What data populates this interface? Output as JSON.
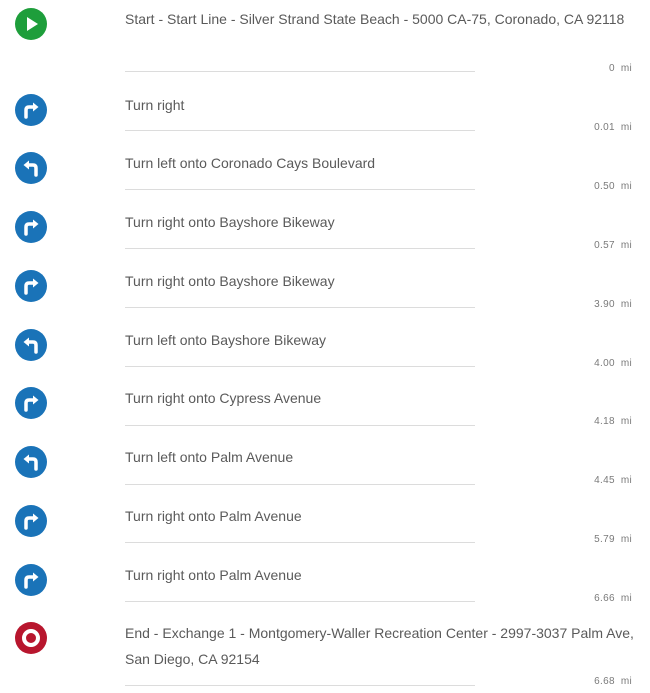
{
  "colors": {
    "start": "#1e9e3b",
    "turn": "#1a73b8",
    "end": "#b8162e"
  },
  "steps": [
    {
      "type": "start",
      "icon": "play-icon",
      "text": "Start - Start Line - Silver Strand State Beach - 5000 CA-75, Coronado, CA 92118",
      "distance": "0",
      "unit": "mi"
    },
    {
      "type": "right",
      "icon": "turn-right-icon",
      "text": "Turn right",
      "distance": "0.01",
      "unit": "mi"
    },
    {
      "type": "left",
      "icon": "turn-left-icon",
      "text": "Turn left onto Coronado Cays Boulevard",
      "distance": "0.50",
      "unit": "mi"
    },
    {
      "type": "right",
      "icon": "turn-right-icon",
      "text": "Turn right onto Bayshore Bikeway",
      "distance": "0.57",
      "unit": "mi"
    },
    {
      "type": "right",
      "icon": "turn-right-icon",
      "text": "Turn right onto Bayshore Bikeway",
      "distance": "3.90",
      "unit": "mi"
    },
    {
      "type": "left",
      "icon": "turn-left-icon",
      "text": "Turn left onto Bayshore Bikeway",
      "distance": "4.00",
      "unit": "mi"
    },
    {
      "type": "right",
      "icon": "turn-right-icon",
      "text": "Turn right onto Cypress Avenue",
      "distance": "4.18",
      "unit": "mi"
    },
    {
      "type": "left",
      "icon": "turn-left-icon",
      "text": "Turn left onto Palm Avenue",
      "distance": "4.45",
      "unit": "mi"
    },
    {
      "type": "right",
      "icon": "turn-right-icon",
      "text": "Turn right onto Palm Avenue",
      "distance": "5.79",
      "unit": "mi"
    },
    {
      "type": "right",
      "icon": "turn-right-icon",
      "text": "Turn right onto Palm Avenue",
      "distance": "6.66",
      "unit": "mi"
    },
    {
      "type": "end",
      "icon": "stop-icon",
      "text": "End - Exchange 1 - Montgomery-Waller Recreation Center - 2997-3037 Palm Ave, San Diego, CA 92154",
      "distance": "6.68",
      "unit": "mi"
    }
  ]
}
